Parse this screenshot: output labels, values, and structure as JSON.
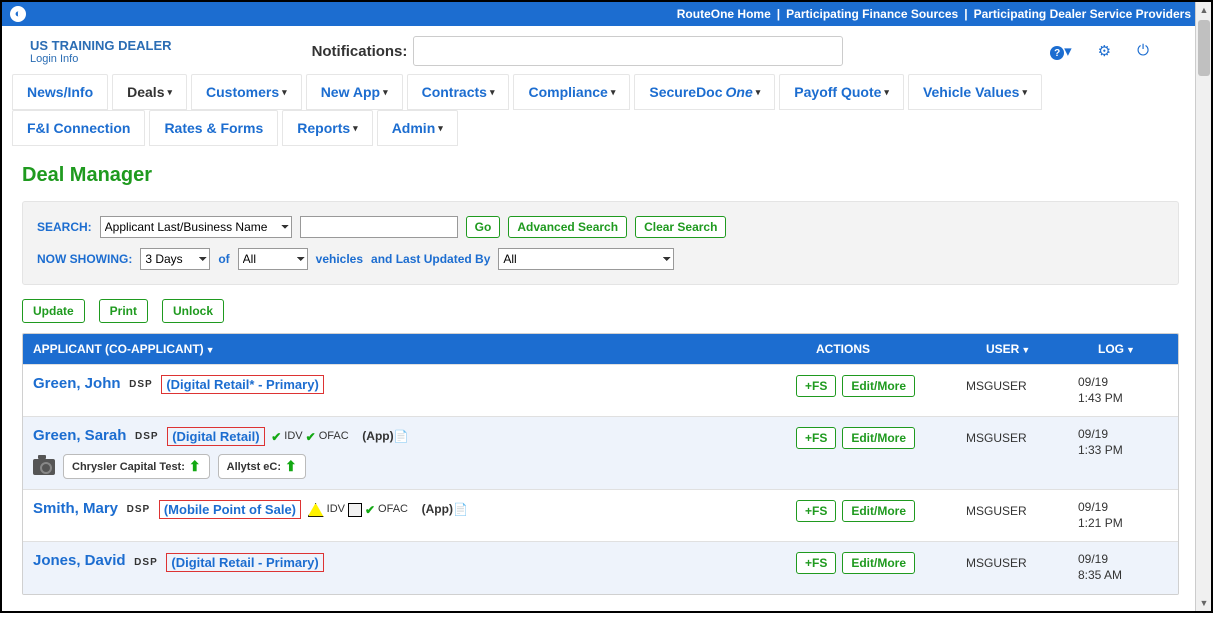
{
  "topbar": {
    "links": [
      "RouteOne Home",
      "Participating Finance Sources",
      "Participating Dealer Service Providers"
    ]
  },
  "header": {
    "dealer_name": "US TRAINING DEALER",
    "login_info": "Login Info",
    "notif_label": "Notifications:"
  },
  "nav": {
    "row1": [
      "News/Info",
      "Deals",
      "Customers",
      "New App",
      "Contracts",
      "Compliance",
      "SecureDoc",
      "One",
      "Payoff Quote",
      "Vehicle Values"
    ],
    "row2": [
      "F&I Connection",
      "Rates & Forms",
      "Reports",
      "Admin"
    ]
  },
  "page_title": "Deal Manager",
  "search": {
    "label_search": "SEARCH:",
    "field_select": "Applicant Last/Business Name",
    "go": "Go",
    "advanced": "Advanced Search",
    "clear": "Clear Search",
    "label_showing": "NOW SHOWING:",
    "days": "3 Days",
    "of": "of",
    "all1": "All",
    "vehicles": "vehicles",
    "and_last": "and Last Updated By",
    "all2": "All"
  },
  "actions": {
    "update": "Update",
    "print": "Print",
    "unlock": "Unlock"
  },
  "thead": {
    "applicant": "APPLICANT (CO-APPLICANT)",
    "actions": "ACTIONS",
    "user": "USER",
    "log": "LOG"
  },
  "row_btn": {
    "fs": "+FS",
    "edit": "Edit/More"
  },
  "rows": [
    {
      "name": "Green, John",
      "dsp": "DSP",
      "box": "(Digital Retail* - Primary)",
      "user": "MSGUSER",
      "date": "09/19",
      "time": "1:43 PM"
    },
    {
      "name": "Green, Sarah",
      "dsp": "DSP",
      "box": "(Digital Retail)",
      "idv": "IDV",
      "ofac": "OFAC",
      "app": "(App)",
      "pill1": "Chrysler Capital Test:",
      "pill2": "Allytst eC:",
      "user": "MSGUSER",
      "date": "09/19",
      "time": "1:33 PM"
    },
    {
      "name": "Smith, Mary",
      "dsp": "DSP",
      "box": "(Mobile Point of Sale)",
      "idv": "IDV",
      "ofac": "OFAC",
      "app": "(App)",
      "user": "MSGUSER",
      "date": "09/19",
      "time": "1:21 PM"
    },
    {
      "name": "Jones, David",
      "dsp": "DSP",
      "box": "(Digital Retail - Primary)",
      "user": "MSGUSER",
      "date": "09/19",
      "time": "8:35 AM"
    }
  ]
}
